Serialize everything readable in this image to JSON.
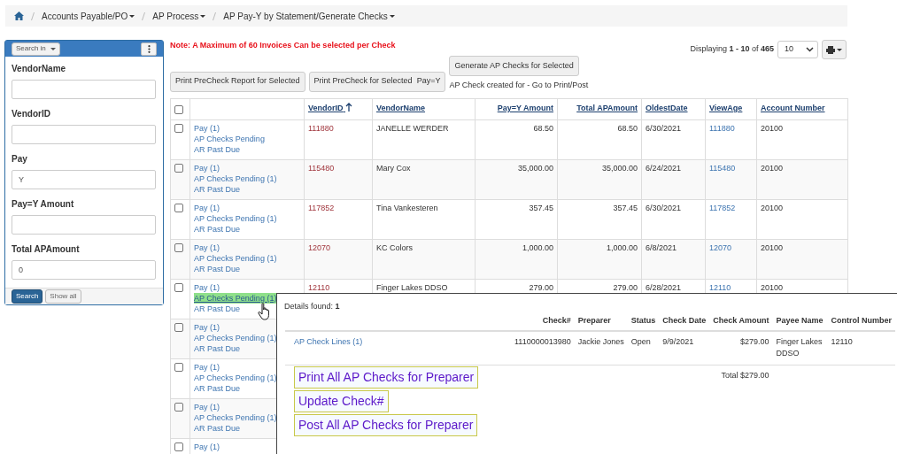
{
  "breadcrumb": [
    {
      "text": "Accounts Payable/PO",
      "dropdown": true
    },
    {
      "text": "AP Process",
      "dropdown": true
    },
    {
      "text": "AP Pay-Y by Statement/Generate Checks",
      "dropdown": true
    }
  ],
  "search_panel": {
    "search_in": "Search in",
    "fields": [
      {
        "label": "VendorName"
      },
      {
        "label": "VendorID"
      },
      {
        "label": "Pay",
        "value": "Y"
      },
      {
        "label": "Pay=Y Amount"
      },
      {
        "label": "Total APAmount",
        "value": "0"
      }
    ],
    "buttons": [
      {
        "text": "Search",
        "kind": "primary"
      },
      {
        "text": "Show all",
        "kind": "secondary"
      }
    ]
  },
  "note": "Note: A Maximum of 60 Invoices Can be selected per Check",
  "displaying": "Displaying **1 - 10** of **465**",
  "page_size": "10",
  "actions": [
    "Print PreCheck Report for Selected",
    "Print PreCheck for Selected  Pay=Y",
    "Generate AP Checks for Selected"
  ],
  "status_text": "AP Check created for - Go to Print/Post",
  "table": {
    "columns": [
      {
        "kind": "checkbox",
        "checked": false
      },
      {
        "kind": "blank"
      },
      {
        "kind": "text",
        "label": "VendorID",
        "sorted": true
      },
      {
        "kind": "text",
        "label": "VendorName",
        "sorted": false
      },
      {
        "kind": "text",
        "label": "Pay=Y Amount",
        "sorted": false
      },
      {
        "kind": "text",
        "label": "Total APAmount",
        "sorted": false
      },
      {
        "kind": "text",
        "label": "OldestDate",
        "sorted": false
      },
      {
        "kind": "text",
        "label": "ViewAge",
        "sorted": false
      },
      {
        "kind": "text",
        "label": "Account Number",
        "sorted": false
      }
    ],
    "rows": [
      {
        "cells": [
          {
            "kind": "checkbox",
            "checked": false
          },
          {
            "kind": "links",
            "links": [
              {
                "text": "Pay (1)",
                "hovered": false
              },
              {
                "text": "AP Checks Pending",
                "hovered": false
              },
              {
                "text": "AR Past Due",
                "hovered": false
              }
            ]
          },
          {
            "kind": "text",
            "text": "111880"
          },
          {
            "kind": "text",
            "text": "JANELLE WERDER"
          },
          {
            "kind": "text",
            "text": "68.50"
          },
          {
            "kind": "text",
            "text": "68.50"
          },
          {
            "kind": "text",
            "text": "6/30/2021"
          },
          {
            "kind": "text",
            "text": "111880"
          },
          {
            "kind": "text",
            "text": "20100"
          }
        ]
      },
      {
        "cells": [
          {
            "kind": "checkbox",
            "checked": false
          },
          {
            "kind": "links",
            "links": [
              {
                "text": "Pay (1)",
                "hovered": false
              },
              {
                "text": "AP Checks Pending (1)",
                "hovered": false
              },
              {
                "text": "AR Past Due",
                "hovered": false
              }
            ]
          },
          {
            "kind": "text",
            "text": "115480"
          },
          {
            "kind": "text",
            "text": "Mary Cox"
          },
          {
            "kind": "text",
            "text": "35,000.00"
          },
          {
            "kind": "text",
            "text": "35,000.00"
          },
          {
            "kind": "text",
            "text": "6/24/2021"
          },
          {
            "kind": "text",
            "text": "115480"
          },
          {
            "kind": "text",
            "text": "20100"
          }
        ]
      },
      {
        "cells": [
          {
            "kind": "checkbox",
            "checked": false
          },
          {
            "kind": "links",
            "links": [
              {
                "text": "Pay (1)",
                "hovered": false
              },
              {
                "text": "AP Checks Pending (1)",
                "hovered": false
              },
              {
                "text": "AR Past Due",
                "hovered": false
              }
            ]
          },
          {
            "kind": "text",
            "text": "117852"
          },
          {
            "kind": "text",
            "text": "Tina Vankesteren"
          },
          {
            "kind": "text",
            "text": "357.45"
          },
          {
            "kind": "text",
            "text": "357.45"
          },
          {
            "kind": "text",
            "text": "6/30/2021"
          },
          {
            "kind": "text",
            "text": "117852"
          },
          {
            "kind": "text",
            "text": "20100"
          }
        ]
      },
      {
        "cells": [
          {
            "kind": "checkbox",
            "checked": false
          },
          {
            "kind": "links",
            "links": [
              {
                "text": "Pay (1)",
                "hovered": false
              },
              {
                "text": "AP Checks Pending (1)",
                "hovered": false
              },
              {
                "text": "AR Past Due",
                "hovered": false
              }
            ]
          },
          {
            "kind": "text",
            "text": "12070"
          },
          {
            "kind": "text",
            "text": "KC Colors"
          },
          {
            "kind": "text",
            "text": "1,000.00"
          },
          {
            "kind": "text",
            "text": "1,000.00"
          },
          {
            "kind": "text",
            "text": "6/8/2021"
          },
          {
            "kind": "text",
            "text": "12070"
          },
          {
            "kind": "text",
            "text": "20100"
          }
        ]
      },
      {
        "cells": [
          {
            "kind": "checkbox",
            "checked": false
          },
          {
            "kind": "links",
            "links": [
              {
                "text": "Pay (1)",
                "hovered": false
              },
              {
                "text": "AP Checks Pending (1)",
                "hovered": true
              },
              {
                "text": "AR Past Due",
                "hovered": false
              }
            ]
          },
          {
            "kind": "text",
            "text": "12110"
          },
          {
            "kind": "text",
            "text": "Finger Lakes DDSO"
          },
          {
            "kind": "text",
            "text": "279.00"
          },
          {
            "kind": "text",
            "text": "279.00"
          },
          {
            "kind": "text",
            "text": "6/28/2021"
          },
          {
            "kind": "text",
            "text": "12110"
          },
          {
            "kind": "text",
            "text": "20100"
          }
        ]
      },
      {
        "cells": [
          {
            "kind": "checkbox",
            "checked": false
          },
          {
            "kind": "links",
            "links": [
              {
                "text": "Pay (1)",
                "hovered": false
              },
              {
                "text": "AP Checks Pending (1)",
                "hovered": false
              },
              {
                "text": "AR Past Due",
                "hovered": false
              }
            ]
          }
        ]
      },
      {
        "cells": [
          {
            "kind": "checkbox",
            "checked": false
          },
          {
            "kind": "links",
            "links": [
              {
                "text": "Pay (1)",
                "hovered": false
              },
              {
                "text": "AP Checks Pending (1)",
                "hovered": false
              },
              {
                "text": "AR Past Due",
                "hovered": false
              }
            ]
          }
        ]
      },
      {
        "cells": [
          {
            "kind": "checkbox",
            "checked": false
          },
          {
            "kind": "links",
            "links": [
              {
                "text": "Pay (1)",
                "hovered": false
              },
              {
                "text": "AP Checks Pending (1)",
                "hovered": false
              },
              {
                "text": "AR Past Due",
                "hovered": false
              }
            ]
          }
        ]
      },
      {
        "cells": [
          {
            "kind": "checkbox",
            "checked": false
          },
          {
            "kind": "links",
            "links": [
              {
                "text": "Pay (1)",
                "hovered": false
              }
            ]
          }
        ]
      }
    ]
  },
  "details_popup": {
    "found": "Details found: **1**",
    "columns": [
      {
        "kind": "blank"
      },
      {
        "kind": "text",
        "label": "Check#"
      },
      {
        "kind": "text",
        "label": "Preparer"
      },
      {
        "kind": "text",
        "label": "Status"
      },
      {
        "kind": "text",
        "label": "Check Date"
      },
      {
        "kind": "text",
        "label": "Check Amount"
      },
      {
        "kind": "text",
        "label": "Payee Name"
      },
      {
        "kind": "text",
        "label": "Control Number"
      }
    ],
    "rows": [
      {
        "cells": [
          "AP Check Lines (1)",
          "1110000013980",
          "Jackie Jones",
          "Open",
          "9/9/2021",
          "$279.00",
          "Finger Lakes DDSO",
          "12110"
        ]
      }
    ],
    "total": "Total $279.00",
    "buttons": [
      "Print All AP Checks for Preparer",
      "Update Check#",
      "Post All AP Checks for Preparer"
    ]
  }
}
